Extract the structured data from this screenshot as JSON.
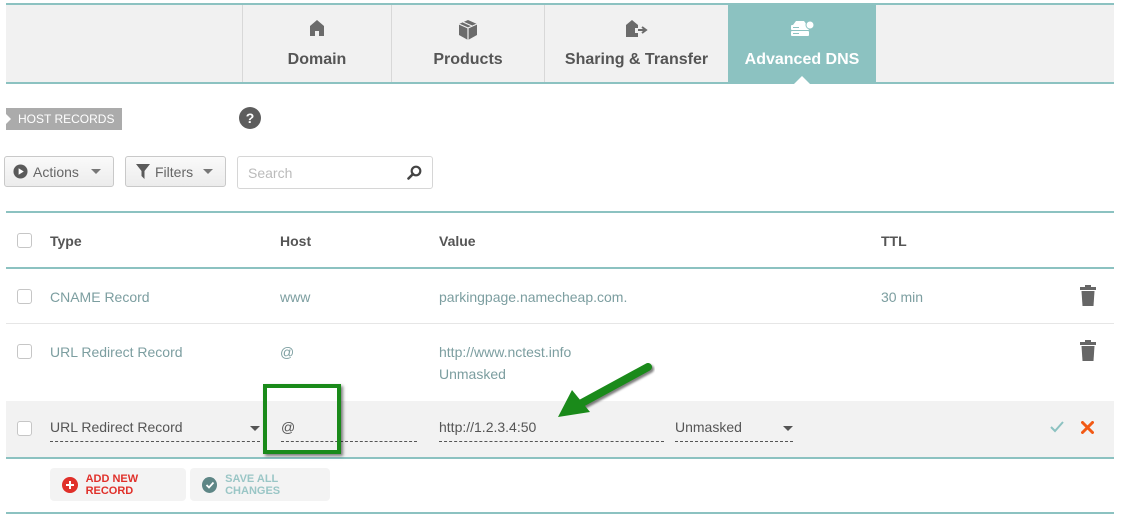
{
  "tabs": [
    {
      "label": "Domain",
      "icon": "house-icon",
      "active": false
    },
    {
      "label": "Products",
      "icon": "box-icon",
      "active": false
    },
    {
      "label": "Sharing & Transfer",
      "icon": "house-arrow-icon",
      "active": false
    },
    {
      "label": "Advanced DNS",
      "icon": "server-gear-icon",
      "active": true
    }
  ],
  "section": {
    "title": "HOST RECORDS",
    "help": "?"
  },
  "toolbar": {
    "actions_label": "Actions",
    "filters_label": "Filters",
    "search_placeholder": "Search",
    "search_value": ""
  },
  "table": {
    "headers": {
      "type": "Type",
      "host": "Host",
      "value": "Value",
      "ttl": "TTL"
    },
    "rows": [
      {
        "type": "CNAME Record",
        "host": "www",
        "value": "parkingpage.namecheap.com.",
        "value2": "",
        "ttl": "30 min"
      },
      {
        "type": "URL Redirect Record",
        "host": "@",
        "value": "http://www.nctest.info",
        "value2": "Unmasked",
        "ttl": ""
      }
    ],
    "edit_row": {
      "type": "URL Redirect Record",
      "host": "@",
      "value": "http://1.2.3.4:50",
      "mask": "Unmasked"
    }
  },
  "footer": {
    "add_label": "ADD NEW RECORD",
    "save_label": "SAVE ALL CHANGES"
  },
  "colors": {
    "accent": "#8cc2c1",
    "add": "#e0302a",
    "cancel": "#f25a16",
    "annotation": "#1a8a1a"
  }
}
